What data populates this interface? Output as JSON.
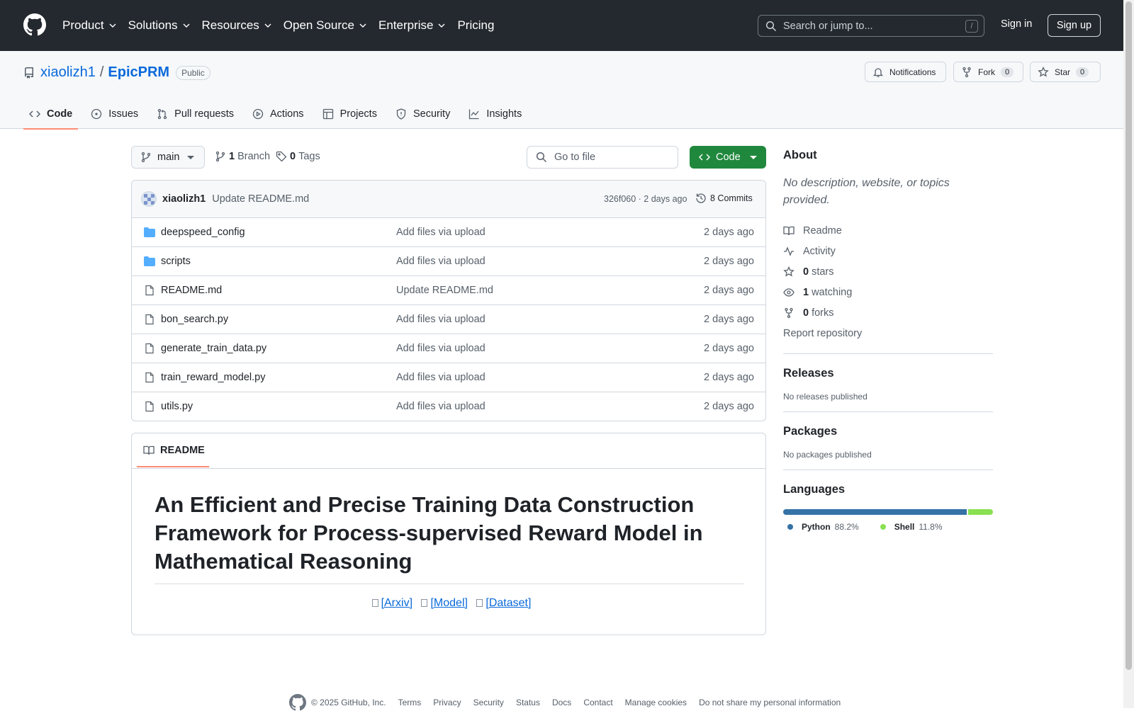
{
  "topbar": {
    "nav": [
      {
        "label": "Product",
        "chevron": true
      },
      {
        "label": "Solutions",
        "chevron": true
      },
      {
        "label": "Resources",
        "chevron": true
      },
      {
        "label": "Open Source",
        "chevron": true
      },
      {
        "label": "Enterprise",
        "chevron": true
      },
      {
        "label": "Pricing",
        "chevron": false
      }
    ],
    "search_placeholder": "Search or jump to...",
    "search_shortcut": "/",
    "signin": "Sign in",
    "signup": "Sign up"
  },
  "repo": {
    "owner": "xiaolizh1",
    "separator": "/",
    "name": "EpicPRM",
    "visibility": "Public",
    "notifications": "Notifications",
    "fork": "Fork",
    "fork_count": "0",
    "star": "Star",
    "star_count": "0"
  },
  "tabs": [
    {
      "label": "Code",
      "icon": "code-icon",
      "active": true
    },
    {
      "label": "Issues",
      "icon": "issue-icon"
    },
    {
      "label": "Pull requests",
      "icon": "pull-request-icon"
    },
    {
      "label": "Actions",
      "icon": "play-icon"
    },
    {
      "label": "Projects",
      "icon": "table-icon"
    },
    {
      "label": "Security",
      "icon": "shield-icon"
    },
    {
      "label": "Insights",
      "icon": "graph-icon"
    }
  ],
  "toolbar": {
    "branch": "main",
    "branch_count": "1",
    "branch_label": "Branch",
    "tag_count": "0",
    "tag_label": "Tags",
    "goto_placeholder": "Go to file",
    "code_button": "Code"
  },
  "commit": {
    "user": "xiaolizh1",
    "message": "Update README.md",
    "meta": "326f060 · 2 days ago",
    "commits": "8 Commits"
  },
  "files": [
    {
      "name": "deepspeed_config",
      "type": "folder",
      "message": "Add files via upload",
      "age": "2 days ago"
    },
    {
      "name": "scripts",
      "type": "folder",
      "message": "Add files via upload",
      "age": "2 days ago"
    },
    {
      "name": "README.md",
      "type": "file",
      "message": "Update README.md",
      "age": "2 days ago"
    },
    {
      "name": "bon_search.py",
      "type": "file",
      "message": "Add files via upload",
      "age": "2 days ago"
    },
    {
      "name": "generate_train_data.py",
      "type": "file",
      "message": "Add files via upload",
      "age": "2 days ago"
    },
    {
      "name": "train_reward_model.py",
      "type": "file",
      "message": "Add files via upload",
      "age": "2 days ago"
    },
    {
      "name": "utils.py",
      "type": "file",
      "message": "Add files via upload",
      "age": "2 days ago"
    }
  ],
  "readme": {
    "tab": "README",
    "title": "An Efficient and Precise Training Data Construction Framework for Process-supervised Reward Model in Mathematical Reasoning",
    "links": [
      "[Arxiv]",
      "[Model]",
      "[Dataset]"
    ]
  },
  "about": {
    "heading": "About",
    "description": "No description, website, or topics provided.",
    "readme": "Readme",
    "activity": "Activity",
    "stars_count": "0",
    "stars": "stars",
    "watching_count": "1",
    "watching": "watching",
    "forks_count": "0",
    "forks": "forks",
    "report": "Report repository"
  },
  "releases": {
    "heading": "Releases",
    "text": "No releases published"
  },
  "packages": {
    "heading": "Packages",
    "text": "No packages published"
  },
  "languages": {
    "heading": "Languages",
    "items": [
      {
        "name": "Python",
        "percent": "88.2%",
        "value": 88.2,
        "color": "#3572A5"
      },
      {
        "name": "Shell",
        "percent": "11.8%",
        "value": 11.8,
        "color": "#89e051"
      }
    ]
  },
  "footer": {
    "copyright": "© 2025 GitHub, Inc.",
    "links": [
      "Terms",
      "Privacy",
      "Security",
      "Status",
      "Docs",
      "Contact",
      "Manage cookies",
      "Do not share my personal information"
    ]
  }
}
